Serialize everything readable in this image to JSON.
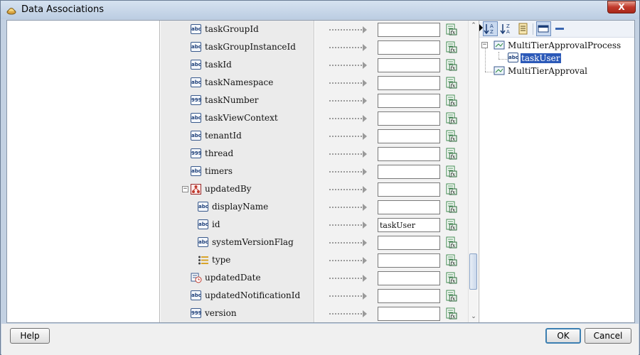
{
  "window": {
    "title": "Data Associations",
    "close_label": "X"
  },
  "source_tree": {
    "rows": [
      {
        "label": "taskGroupId",
        "icon_type": "string",
        "icon_text": "abc",
        "indent": 0
      },
      {
        "label": "taskGroupInstanceId",
        "icon_type": "string",
        "icon_text": "abc",
        "indent": 0
      },
      {
        "label": "taskId",
        "icon_type": "string",
        "icon_text": "abc",
        "indent": 0
      },
      {
        "label": "taskNamespace",
        "icon_type": "string",
        "icon_text": "abc",
        "indent": 0
      },
      {
        "label": "taskNumber",
        "icon_type": "number",
        "icon_text": "999",
        "indent": 0
      },
      {
        "label": "taskViewContext",
        "icon_type": "string",
        "icon_text": "abc",
        "indent": 0
      },
      {
        "label": "tenantId",
        "icon_type": "string",
        "icon_text": "abc",
        "indent": 0
      },
      {
        "label": "thread",
        "icon_type": "number",
        "icon_text": "999",
        "indent": 0
      },
      {
        "label": "timers",
        "icon_type": "string",
        "icon_text": "abc",
        "indent": 0
      },
      {
        "label": "updatedBy",
        "icon_type": "complex",
        "icon_text": "",
        "indent": 0,
        "expanded": true
      },
      {
        "label": "displayName",
        "icon_type": "string",
        "icon_text": "abc",
        "indent": 1
      },
      {
        "label": "id",
        "icon_type": "string",
        "icon_text": "abc",
        "indent": 1
      },
      {
        "label": "systemVersionFlag",
        "icon_type": "string",
        "icon_text": "abc",
        "indent": 1
      },
      {
        "label": "type",
        "icon_type": "enum",
        "icon_text": "",
        "indent": 1
      },
      {
        "label": "updatedDate",
        "icon_type": "date",
        "icon_text": "",
        "indent": 0
      },
      {
        "label": "updatedNotificationId",
        "icon_type": "string",
        "icon_text": "abc",
        "indent": 0
      },
      {
        "label": "version",
        "icon_type": "number",
        "icon_text": "999",
        "indent": 0
      }
    ]
  },
  "mapping": {
    "values": [
      "",
      "",
      "",
      "",
      "",
      "",
      "",
      "",
      "",
      "",
      "",
      "taskUser",
      "",
      "",
      "",
      "",
      ""
    ],
    "expression_icon": "expression-builder-icon"
  },
  "target_tree": {
    "nodes": [
      {
        "label": "MultiTierApprovalProcess",
        "level": 0,
        "expanded": true,
        "selected": false
      },
      {
        "label": "taskUser",
        "level": 1,
        "icon_text": "abc",
        "selected": true
      },
      {
        "label": "MultiTierApproval",
        "level": 0,
        "expanded": false,
        "selected": false
      }
    ]
  },
  "footer": {
    "help_label": "Help",
    "ok_label": "OK",
    "cancel_label": "Cancel"
  },
  "colors": {
    "selection": "#2b59b8",
    "default_button_border": "#3c7fb1",
    "close_button": "#c0392b"
  }
}
